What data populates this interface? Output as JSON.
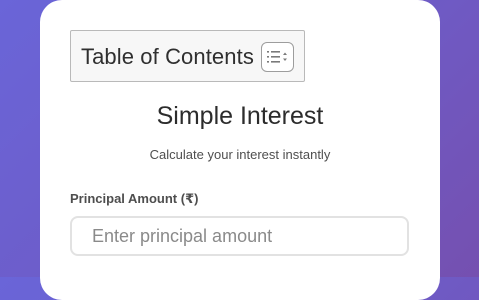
{
  "toc": {
    "title": "Table of Contents",
    "toggle_icon": "list-toggle-icon"
  },
  "calculator": {
    "heading": "Simple Interest",
    "subheading": "Calculate your interest instantly",
    "principal": {
      "label": "Principal Amount (₹)",
      "placeholder": "Enter principal amount",
      "value": ""
    }
  },
  "colors": {
    "background_start": "#6a65d8",
    "background_end": "#7550b0",
    "card": "#ffffff",
    "input_border": "#e2e2e2"
  }
}
